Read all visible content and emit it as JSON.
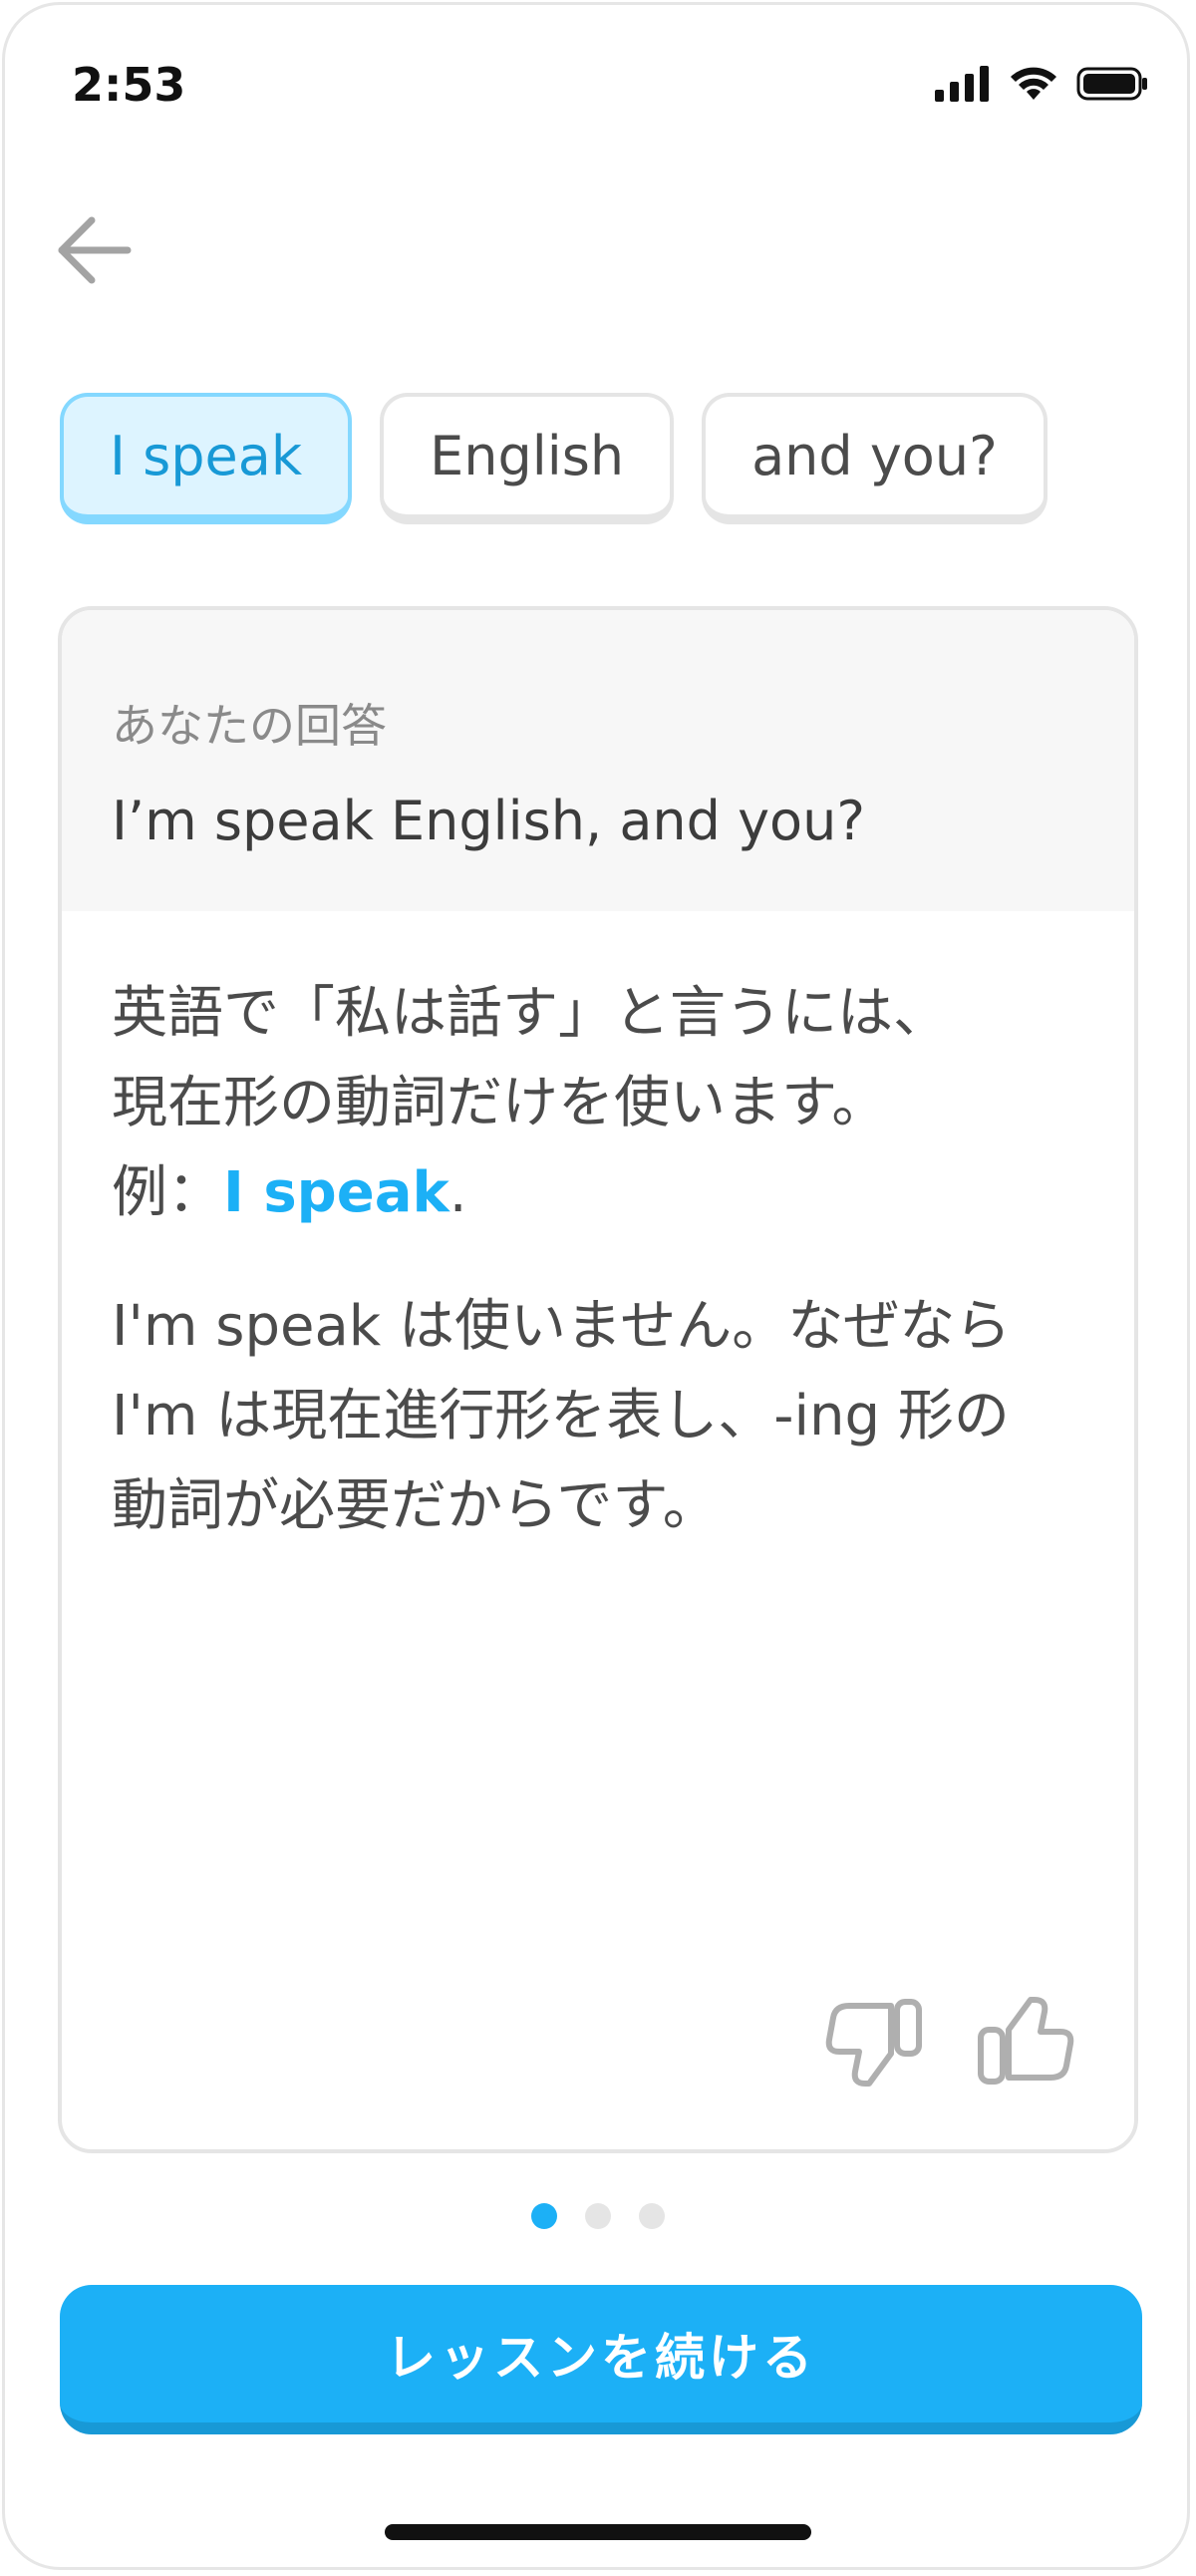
{
  "status_bar": {
    "time": "2:53",
    "icons": [
      "signal-icon",
      "wifi-icon",
      "battery-icon"
    ]
  },
  "nav": {
    "back_icon": "arrow-left-icon"
  },
  "word_chips": [
    {
      "label": "I speak",
      "selected": true
    },
    {
      "label": "English",
      "selected": false
    },
    {
      "label": "and you?",
      "selected": false
    }
  ],
  "feedback_card": {
    "answer_label": "あなたの回答",
    "answer_text": "I’m speak English, and you?",
    "explanation_line1": "英語で「私は話す」と言うには、",
    "explanation_line2": "現在形の動詞だけを使います。",
    "example_prefix": "例：",
    "example_highlight": "I speak",
    "example_suffix": ".",
    "note_line1": "I'm speak は使いません。なぜなら",
    "note_line2": "I'm は現在進行形を表し、-ing 形の",
    "note_line3": "動詞が必要だからです。",
    "rating_icons": [
      "thumbs-down-icon",
      "thumbs-up-icon"
    ]
  },
  "pagination": {
    "total": 3,
    "current": 1
  },
  "continue_button": {
    "label": "レッスンを続ける"
  },
  "colors": {
    "accent": "#1cb0f6",
    "accent_dark": "#1899d6",
    "chip_selected_bg": "#ddf4ff",
    "chip_selected_border": "#84d8ff",
    "border": "#e5e5e5",
    "text": "#4b4b4b"
  }
}
